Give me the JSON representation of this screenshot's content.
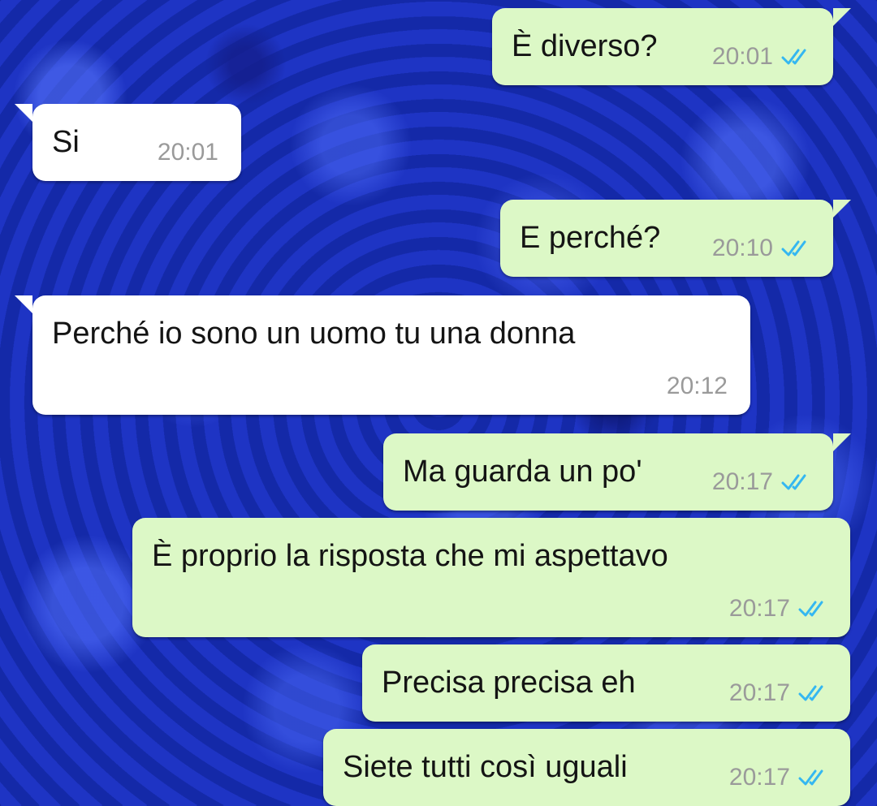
{
  "chat": {
    "messages": [
      {
        "text": "È diverso?",
        "time": "20:01",
        "direction": "outgoing",
        "status": "read"
      },
      {
        "text": "Si",
        "time": "20:01",
        "direction": "incoming"
      },
      {
        "text": "E perché?",
        "time": "20:10",
        "direction": "outgoing",
        "status": "read"
      },
      {
        "text": "Perché io sono un uomo tu una donna",
        "time": "20:12",
        "direction": "incoming"
      },
      {
        "text": "Ma guarda un po'",
        "time": "20:17",
        "direction": "outgoing",
        "status": "read"
      },
      {
        "text": "È proprio la risposta che mi aspettavo",
        "time": "20:17",
        "direction": "outgoing",
        "status": "read"
      },
      {
        "text": "Precisa precisa eh",
        "time": "20:17",
        "direction": "outgoing",
        "status": "read"
      },
      {
        "text": "Siete tutti così uguali",
        "time": "20:17",
        "direction": "outgoing",
        "status": "read"
      }
    ]
  },
  "colors": {
    "outgoing_bubble": "#dcf8c6",
    "incoming_bubble": "#ffffff",
    "read_ticks": "#34b7f1",
    "background": "#1a2fb8"
  },
  "icons": {
    "read_receipt": "double-check-icon"
  }
}
